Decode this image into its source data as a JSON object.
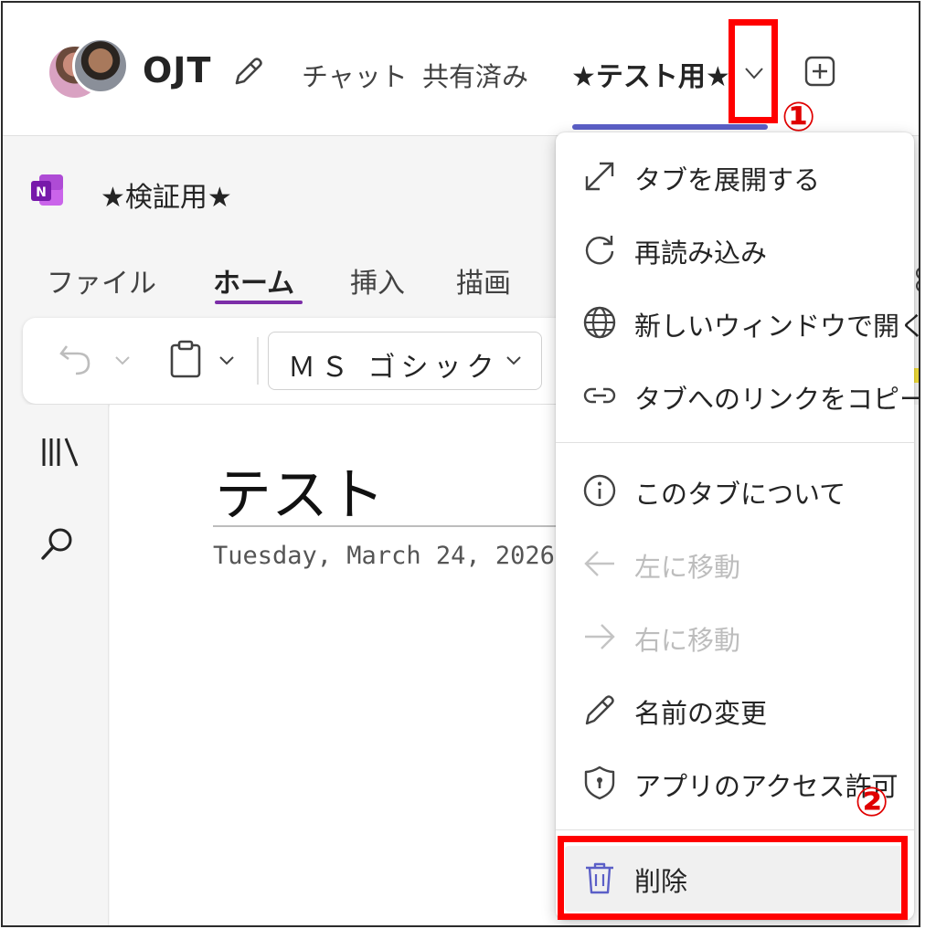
{
  "header": {
    "team_name": "OJT",
    "tabs": [
      {
        "label": "チャット"
      },
      {
        "label": "共有済み"
      },
      {
        "label": "★テスト用★"
      }
    ]
  },
  "notebook": {
    "title": "★検証用★",
    "ribbon_tabs": [
      "ファイル",
      "ホーム",
      "挿入",
      "描画"
    ],
    "font": "ＭＳ ゴシック"
  },
  "page": {
    "title": "テスト",
    "date": "Tuesday, March 24, 2026"
  },
  "menu": {
    "items": [
      {
        "label": "タブを展開する",
        "icon": "expand-icon"
      },
      {
        "label": "再読み込み",
        "icon": "refresh-icon"
      },
      {
        "label": "新しいウィンドウで開く",
        "icon": "globe-icon"
      },
      {
        "label": "タブへのリンクをコピー",
        "icon": "link-icon"
      },
      {
        "label": "このタブについて",
        "icon": "info-icon"
      },
      {
        "label": "左に移動",
        "icon": "arrow-left-icon",
        "disabled": true
      },
      {
        "label": "右に移動",
        "icon": "arrow-right-icon",
        "disabled": true
      },
      {
        "label": "名前の変更",
        "icon": "pencil-icon"
      },
      {
        "label": "アプリのアクセス許可",
        "icon": "shield-icon"
      },
      {
        "label": "削除",
        "icon": "trash-icon"
      }
    ]
  },
  "annotations": {
    "step1": "①",
    "step2": "②",
    "highlight_color": "#ff0000"
  },
  "colors": {
    "accent": "#5b5fc7",
    "onenote": "#7c2ea8"
  }
}
